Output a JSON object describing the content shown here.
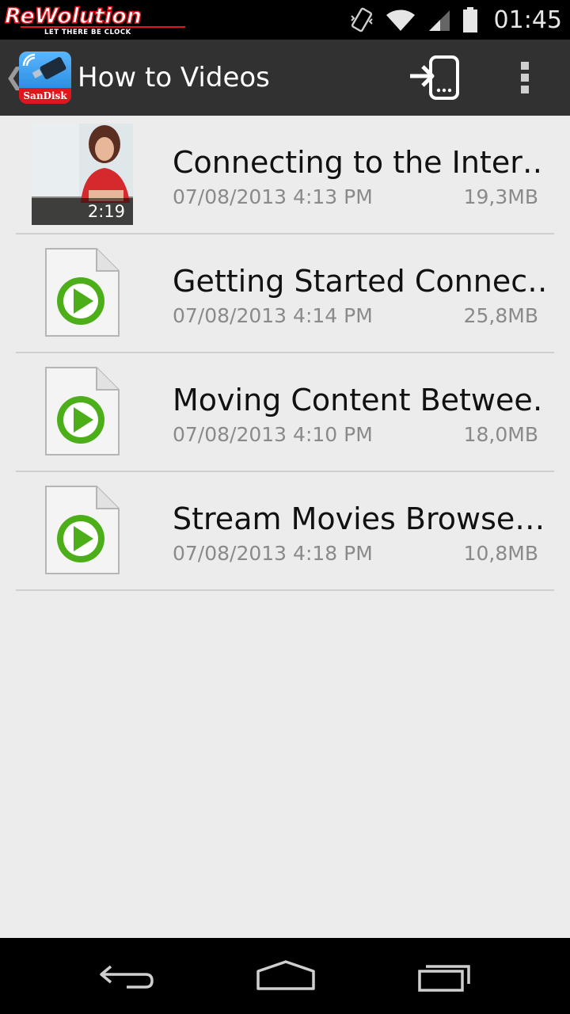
{
  "status_bar": {
    "logo_text": "ReWolution",
    "logo_tagline": "LET THERE BE CLOCK",
    "time": "01:45",
    "icons": [
      "vibrate-icon",
      "wifi-icon",
      "signal-icon",
      "battery-icon"
    ]
  },
  "action_bar": {
    "title": "How to Videos",
    "app_icon_brand": "SanDisk",
    "actions": [
      "transfer-to-device-icon",
      "overflow-menu-icon"
    ]
  },
  "videos": [
    {
      "title": "Connecting to the Inter…",
      "date": "07/08/2013 4:13 PM",
      "size": "19,3MB",
      "duration": "2:19",
      "has_thumbnail": true
    },
    {
      "title": "Getting Started Connec…",
      "date": "07/08/2013 4:14 PM",
      "size": "25,8MB",
      "has_thumbnail": false
    },
    {
      "title": "Moving Content Betwee…",
      "date": "07/08/2013 4:10 PM",
      "size": "18,0MB",
      "has_thumbnail": false
    },
    {
      "title": "Stream Movies Browse…",
      "date": "07/08/2013 4:18 PM",
      "size": "10,8MB",
      "has_thumbnail": false
    }
  ],
  "navigation_bar": {
    "buttons": [
      "back-icon",
      "home-icon",
      "recents-icon"
    ]
  },
  "colors": {
    "action_bar": "#313131",
    "list_background": "#ececec",
    "play_green": "#4caf1a",
    "brand_red": "#e0161c"
  }
}
